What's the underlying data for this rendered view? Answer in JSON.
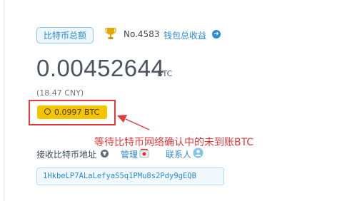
{
  "wallet": {
    "badge_label": "比特币总额",
    "rank": "No.4583",
    "earnings_link": "钱包总收益",
    "balance": "0.00452644",
    "balance_unit": "BTC",
    "fiat_value": "(18.47 CNY)",
    "pending_amount": "0.0997 BTC"
  },
  "annotation": {
    "text": "等待比特币网络确认中的未到账BTC",
    "color": "#e03a3a"
  },
  "receive": {
    "label": "接收比特币地址",
    "manage_link": "管理",
    "contacts_link": "联系人",
    "address": "1HkbeLP7ALaLefyaS5q1PMu8s2Pdy9gEQB"
  },
  "icons": {
    "trophy": "trophy-icon",
    "arrow": "arrow-right-circle-icon",
    "clock": "clock-icon",
    "down": "chevron-down-circle-icon",
    "manage": "manage-icon",
    "contacts": "contacts-icon"
  },
  "colors": {
    "accent": "#2a8ad4",
    "pending_bg": "#f5c400",
    "highlight": "#e03a3a"
  }
}
